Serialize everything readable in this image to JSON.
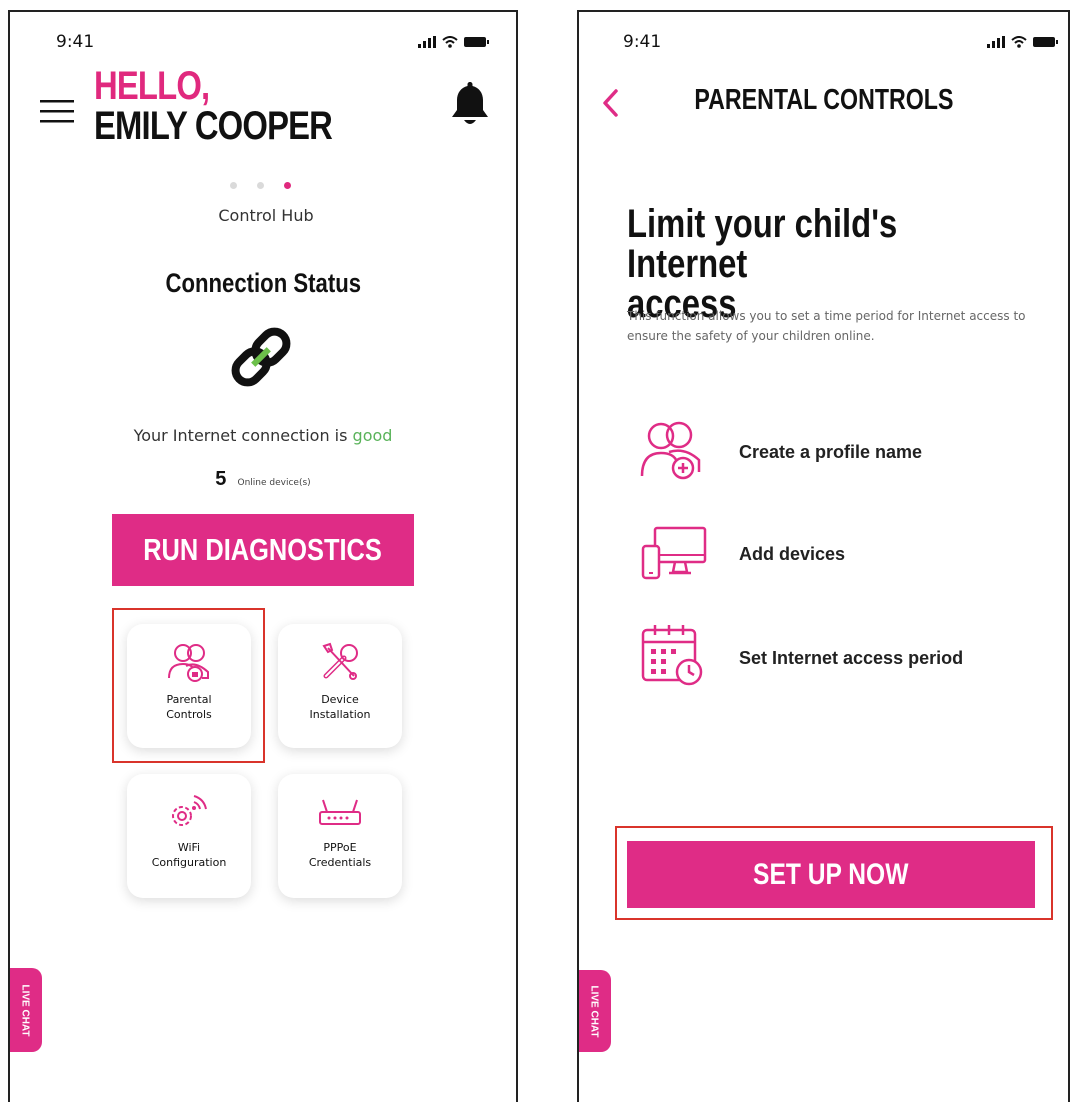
{
  "colors": {
    "accent": "#df2c86",
    "good": "#5ab35a",
    "highlight_frame": "#d9342b"
  },
  "home": {
    "status_time": "9:41",
    "greeting_line1": "HELLO,",
    "greeting_line2": "EMILY COOPER",
    "carousel_label": "Control Hub",
    "connection_title": "Connection Status",
    "connection_text": "Your Internet connection is ",
    "connection_quality": "good",
    "online_count": "5",
    "online_label": "Online device(s)",
    "run_button": "RUN DIAGNOSTICS",
    "tiles": [
      {
        "line1": "Parental",
        "line2": "Controls",
        "icon": "parental-controls-icon"
      },
      {
        "line1": "Device",
        "line2": "Installation",
        "icon": "tools-icon"
      },
      {
        "line1": "WiFi",
        "line2": "Configuration",
        "icon": "wifi-gear-icon"
      },
      {
        "line1": "PPPoE",
        "line2": "Credentials",
        "icon": "router-icon"
      }
    ],
    "live_chat": "LIVE CHAT"
  },
  "parental": {
    "status_time": "9:41",
    "title": "PARENTAL CONTROLS",
    "headline_line1": "Limit your child's Internet",
    "headline_line2": "access",
    "description": "This function allows you to set a time period for Internet access to ensure the safety of your children online.",
    "steps": [
      {
        "label": "Create a profile name",
        "icon": "profile-add-icon"
      },
      {
        "label": "Add devices",
        "icon": "devices-icon"
      },
      {
        "label": "Set Internet access period",
        "icon": "calendar-clock-icon"
      }
    ],
    "setup_button": "SET UP NOW",
    "live_chat": "LIVE CHAT"
  }
}
